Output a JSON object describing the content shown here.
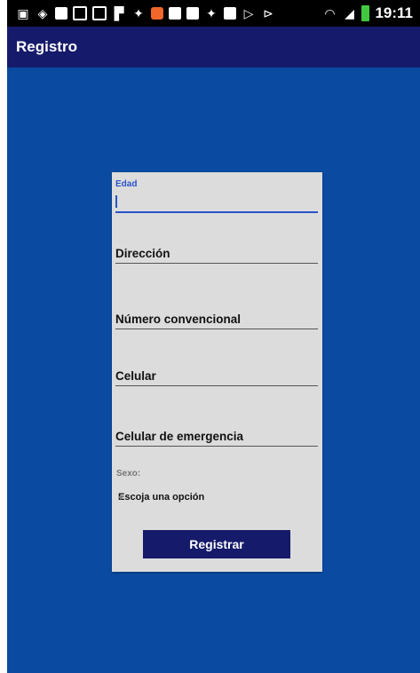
{
  "status_bar": {
    "icons": [
      "flipboard-icon",
      "location-icon",
      "notes-icon",
      "image-icon",
      "email-icon",
      "app-icon",
      "twitter-icon",
      "play-icon",
      "youtube-icon",
      "youtube-icon",
      "twitter-icon",
      "youtube-icon",
      "play-store-icon",
      "play-store-icon"
    ],
    "time": "19:11",
    "battery_color": "#42c840"
  },
  "app_bar": {
    "title": "Registro",
    "color": "#161a6b"
  },
  "form": {
    "fields": [
      {
        "label": "Edad",
        "value": "",
        "focused": true
      },
      {
        "label": "Dirección"
      },
      {
        "label": "Número convencional"
      },
      {
        "label": "Celular"
      },
      {
        "label": "Celular de emergencia"
      }
    ],
    "sexo_label": "Sexo:",
    "sexo_select": {
      "selected": "Escoja una opción"
    },
    "submit_label": "Registrar"
  },
  "colors": {
    "background": "#0a4aa0",
    "card": "#dcdcdc",
    "accent": "#2a52c9"
  }
}
